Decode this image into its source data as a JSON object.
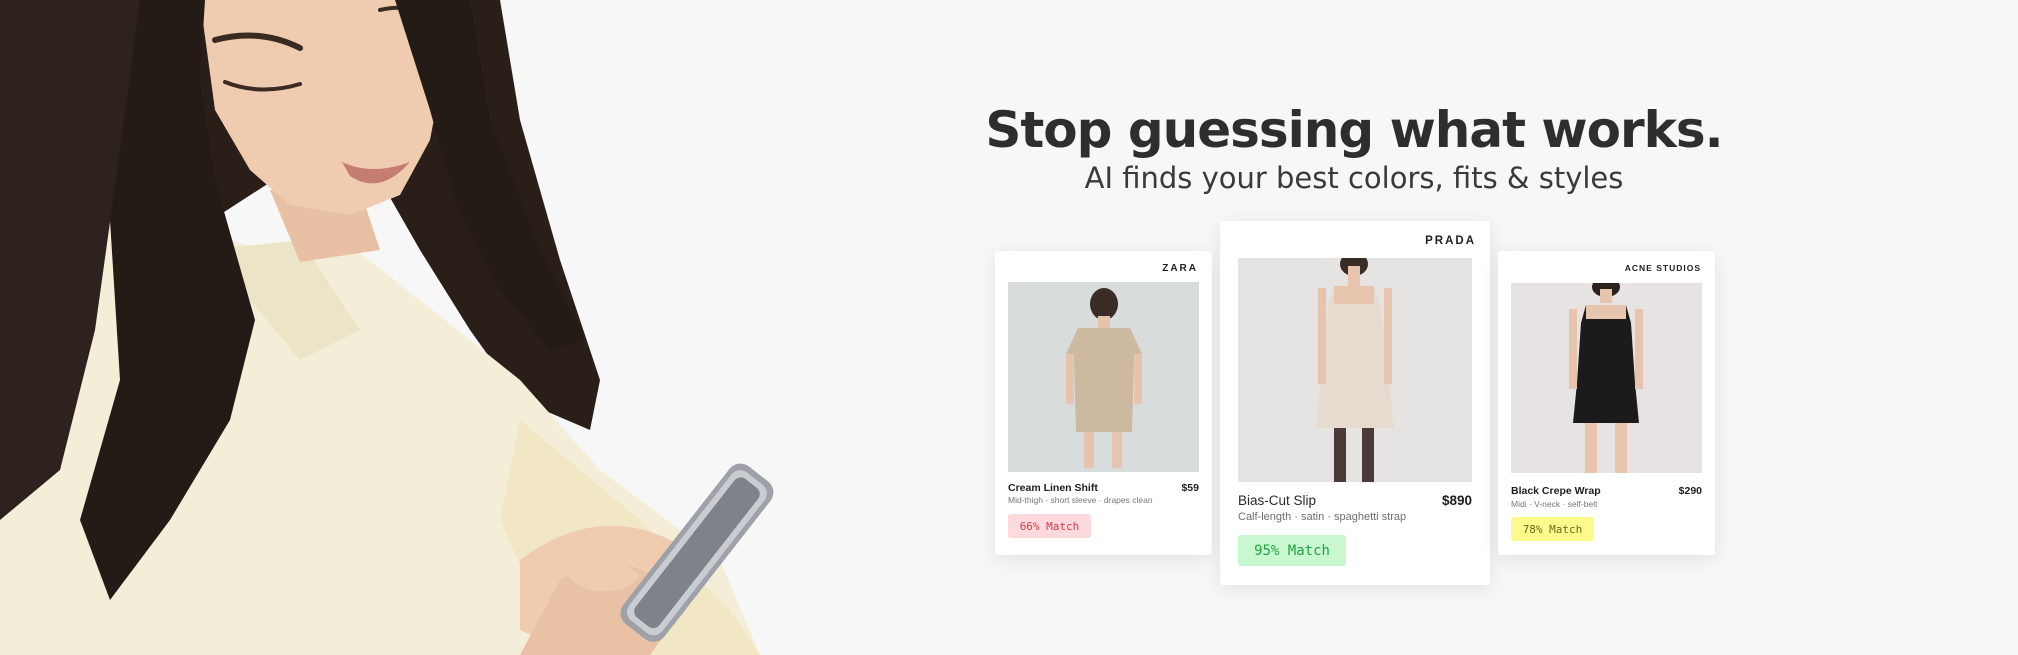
{
  "headline": {
    "title": "Stop guessing what works.",
    "subtitle": "AI finds your best colors, fits & styles"
  },
  "cards": [
    {
      "brand": "ZARA",
      "name": "Cream Linen Shift",
      "price": "$59",
      "description": "Mid-thigh · short sleeve · drapes clean",
      "match": "66% Match",
      "match_color": "#d93a4c",
      "garment_color": "#cbb9a0"
    },
    {
      "brand": "PRADA",
      "name": "Bias-Cut Slip",
      "price": "$890",
      "description": "Calf-length · satin · spaghetti strap",
      "match": "95% Match",
      "match_color": "#24a043",
      "garment_color": "#e5dccf"
    },
    {
      "brand": "ACNE STUDIOS",
      "name": "Black Crepe Wrap",
      "price": "$290",
      "description": "Midi · V-neck · self-belt",
      "match": "78% Match",
      "match_color": "#6b6a18",
      "garment_color": "#1b1b1b"
    }
  ],
  "colors": {
    "background": "#f7f7f7",
    "shirt": "#f6f0dc",
    "hair": "#241a16"
  }
}
